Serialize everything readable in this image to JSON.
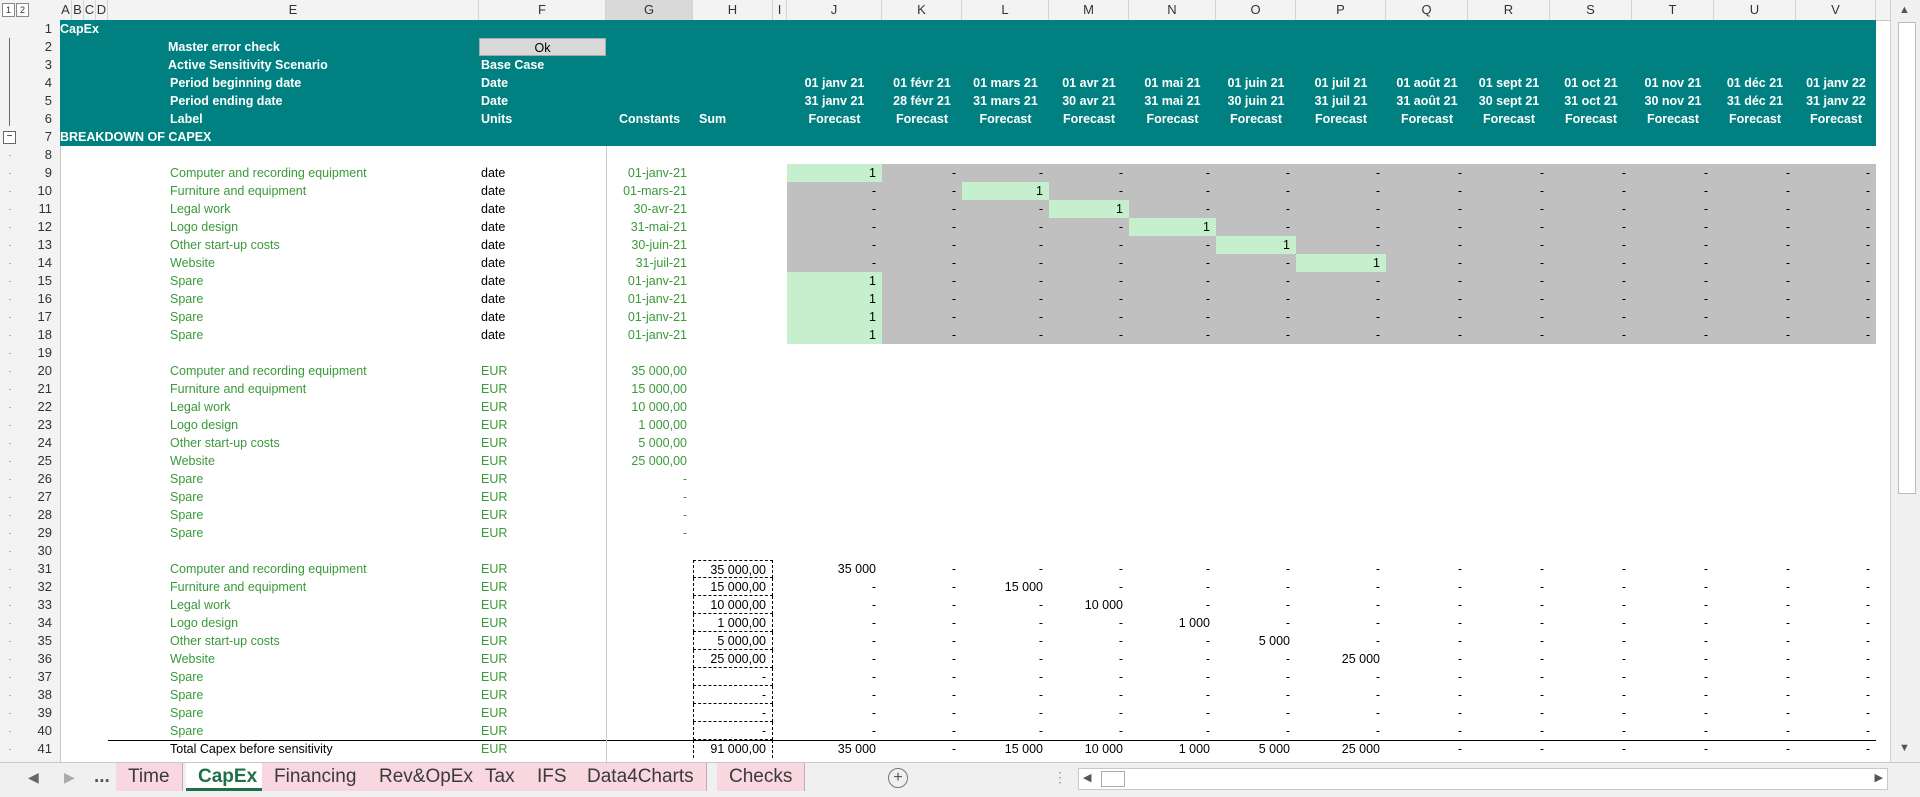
{
  "sheet_title": "CapEx",
  "columns": [
    {
      "name": "A",
      "w": 12
    },
    {
      "name": "B",
      "w": 12
    },
    {
      "name": "C",
      "w": 12
    },
    {
      "name": "D",
      "w": 12
    },
    {
      "name": "E",
      "w": 371
    },
    {
      "name": "F",
      "w": 127
    },
    {
      "name": "G",
      "w": 87
    },
    {
      "name": "H",
      "w": 80
    },
    {
      "name": "I",
      "w": 14
    },
    {
      "name": "J",
      "w": 95
    },
    {
      "name": "K",
      "w": 80
    },
    {
      "name": "L",
      "w": 87
    },
    {
      "name": "M",
      "w": 80
    },
    {
      "name": "N",
      "w": 87
    },
    {
      "name": "O",
      "w": 80
    },
    {
      "name": "P",
      "w": 90
    },
    {
      "name": "Q",
      "w": 82
    },
    {
      "name": "R",
      "w": 82
    },
    {
      "name": "S",
      "w": 82
    },
    {
      "name": "T",
      "w": 82
    },
    {
      "name": "U",
      "w": 82
    },
    {
      "name": "V",
      "w": 80
    }
  ],
  "selected_column": "G",
  "header": {
    "row2": {
      "label": "Master error check",
      "value": "Ok"
    },
    "row3": {
      "label": "Active Sensitivity Scenario",
      "value": "Base Case"
    },
    "row4": {
      "label": "Period beginning date",
      "unit": "Date"
    },
    "row5": {
      "label": "Period ending date",
      "unit": "Date"
    },
    "row6": {
      "label": "Label",
      "unit": "Units",
      "constants": "Constants",
      "sum": "Sum"
    },
    "periods_begin": [
      "01 janv 21",
      "01 févr 21",
      "01 mars 21",
      "01 avr 21",
      "01 mai 21",
      "01 juin 21",
      "01 juil 21",
      "01 août 21",
      "01 sept 21",
      "01 oct 21",
      "01 nov 21",
      "01 déc 21",
      "01 janv 22"
    ],
    "periods_end": [
      "31 janv 21",
      "28 févr 21",
      "31 mars 21",
      "30 avr 21",
      "31 mai 21",
      "30 juin 21",
      "31 juil 21",
      "31 août 21",
      "30 sept 21",
      "31 oct 21",
      "30 nov 21",
      "31 déc 21",
      "31 janv 22"
    ],
    "periods_label": [
      "Forecast",
      "Forecast",
      "Forecast",
      "Forecast",
      "Forecast",
      "Forecast",
      "Forecast",
      "Forecast",
      "Forecast",
      "Forecast",
      "Forecast",
      "Forecast",
      "Forecast"
    ]
  },
  "section_title": "BREAKDOWN OF CAPEX",
  "flag_rows": [
    {
      "label": "Computer and recording equipment",
      "unit": "date",
      "date": "01-janv-21",
      "one_at": 0
    },
    {
      "label": "Furniture and equipment",
      "unit": "date",
      "date": "01-mars-21",
      "one_at": 2
    },
    {
      "label": "Legal work",
      "unit": "date",
      "date": "30-avr-21",
      "one_at": 3
    },
    {
      "label": "Logo design",
      "unit": "date",
      "date": "31-mai-21",
      "one_at": 4
    },
    {
      "label": "Other start-up costs",
      "unit": "date",
      "date": "30-juin-21",
      "one_at": 5
    },
    {
      "label": "Website",
      "unit": "date",
      "date": "31-juil-21",
      "one_at": 6
    },
    {
      "label": "Spare",
      "unit": "date",
      "date": "01-janv-21",
      "one_at": 0
    },
    {
      "label": "Spare",
      "unit": "date",
      "date": "01-janv-21",
      "one_at": 0
    },
    {
      "label": "Spare",
      "unit": "date",
      "date": "01-janv-21",
      "one_at": 0
    },
    {
      "label": "Spare",
      "unit": "date",
      "date": "01-janv-21",
      "one_at": 0
    }
  ],
  "amount_rows": [
    {
      "label": "Computer and recording equipment",
      "unit": "EUR",
      "constant": "35 000,00"
    },
    {
      "label": "Furniture and equipment",
      "unit": "EUR",
      "constant": "15 000,00"
    },
    {
      "label": "Legal work",
      "unit": "EUR",
      "constant": "10 000,00"
    },
    {
      "label": "Logo design",
      "unit": "EUR",
      "constant": "1 000,00"
    },
    {
      "label": "Other start-up costs",
      "unit": "EUR",
      "constant": "5 000,00"
    },
    {
      "label": "Website",
      "unit": "EUR",
      "constant": "25 000,00"
    },
    {
      "label": "Spare",
      "unit": "EUR",
      "constant": "-"
    },
    {
      "label": "Spare",
      "unit": "EUR",
      "constant": "-"
    },
    {
      "label": "Spare",
      "unit": "EUR",
      "constant": "-"
    },
    {
      "label": "Spare",
      "unit": "EUR",
      "constant": "-"
    }
  ],
  "schedule_rows": [
    {
      "label": "Computer and recording equipment",
      "unit": "EUR",
      "sum": "35 000,00",
      "at": 0,
      "value": "35 000"
    },
    {
      "label": "Furniture and equipment",
      "unit": "EUR",
      "sum": "15 000,00",
      "at": 2,
      "value": "15 000"
    },
    {
      "label": "Legal work",
      "unit": "EUR",
      "sum": "10 000,00",
      "at": 3,
      "value": "10 000"
    },
    {
      "label": "Logo design",
      "unit": "EUR",
      "sum": "1 000,00",
      "at": 4,
      "value": "1 000"
    },
    {
      "label": "Other start-up costs",
      "unit": "EUR",
      "sum": "5 000,00",
      "at": 5,
      "value": "5 000"
    },
    {
      "label": "Website",
      "unit": "EUR",
      "sum": "25 000,00",
      "at": 6,
      "value": "25 000"
    },
    {
      "label": "Spare",
      "unit": "EUR",
      "sum": "-",
      "at": -1,
      "value": ""
    },
    {
      "label": "Spare",
      "unit": "EUR",
      "sum": "-",
      "at": -1,
      "value": ""
    },
    {
      "label": "Spare",
      "unit": "EUR",
      "sum": "-",
      "at": -1,
      "value": ""
    },
    {
      "label": "Spare",
      "unit": "EUR",
      "sum": "-",
      "at": -1,
      "value": ""
    }
  ],
  "total_row": {
    "label": "Total Capex before sensitivity",
    "unit": "EUR",
    "sum": "91 000,00",
    "values": [
      "35 000",
      "-",
      "15 000",
      "10 000",
      "1 000",
      "5 000",
      "25 000",
      "-",
      "-",
      "-",
      "-",
      "-",
      "-"
    ]
  },
  "dash": "-",
  "one": "1",
  "tabs": [
    {
      "label": "...",
      "active": false,
      "plain": true
    },
    {
      "label": "Time",
      "active": false
    },
    {
      "label": "CapEx",
      "active": true
    },
    {
      "label": "Financing",
      "active": false
    },
    {
      "label": "Rev&OpEx",
      "active": false
    },
    {
      "label": "Tax",
      "active": false
    },
    {
      "label": "IFS",
      "active": false
    },
    {
      "label": "Data4Charts",
      "active": false
    },
    {
      "label": "Checks",
      "active": false
    }
  ],
  "outline_levels": [
    "1",
    "2"
  ],
  "colors": {
    "teal": "#008080",
    "green_text": "#3a9a3a",
    "highlight": "#c6efce",
    "grey_fill": "#c0c0c0",
    "active_tab": "#1e7145",
    "tab_bg": "#f8d7e0"
  }
}
